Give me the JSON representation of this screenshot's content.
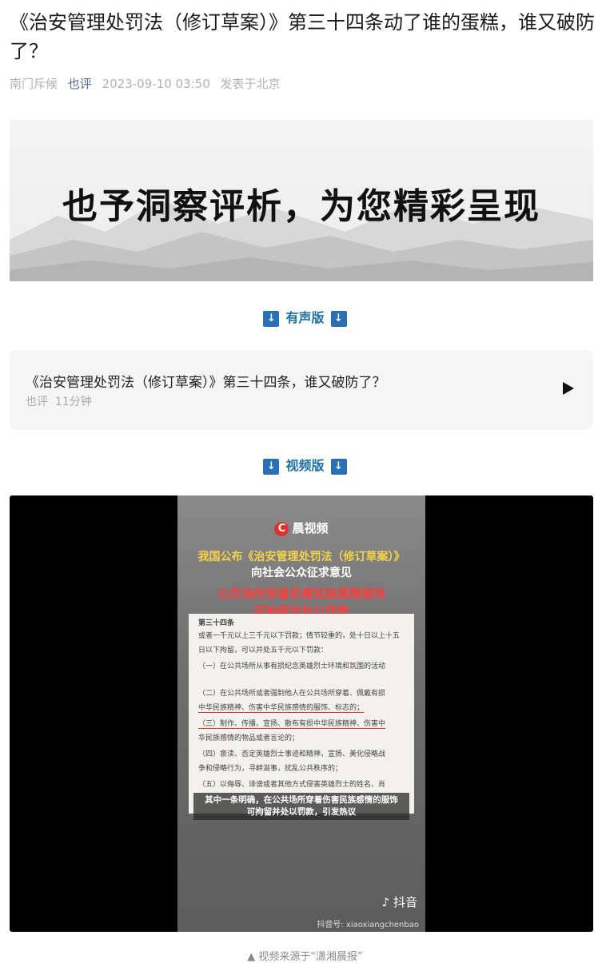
{
  "article": {
    "title": "《治安管理处罚法（修订草案）》第三十四条动了谁的蛋糕，谁又破防了？",
    "author": "南门斥候",
    "account": "也评",
    "datetime": "2023-09-10 03:50",
    "location": "发表于北京"
  },
  "banner": {
    "text": "也予洞察评析，为您精彩呈现"
  },
  "sections": {
    "audio_label": "有声版",
    "video_label": "视频版",
    "arrow_icon": "↓"
  },
  "audio": {
    "title": "《治安管理处罚法（修订草案）》第三十四条，谁又破防了？",
    "source": "也评",
    "duration": "11分钟"
  },
  "video": {
    "brand": "晨视频",
    "headline1": "我国公布《治安管理处罚法（修订草案）》",
    "headline2": "向社会公众征求意见",
    "headline3": "公共场所穿着伤害民族感情服饰",
    "headline4": "可拘留并处以罚款",
    "doc_lines": [
      "第三十四条",
      "或者一千元以上三千元以下罚款；情节较重的，处十日以上十五",
      "日以下拘留，可以并处五千元以下罚款：",
      "（一）在公共场所从事有损纪念英雄烈士环境和氛围的活动",
      "（二）在公共场所或者强制他人在公共场所穿着、佩戴有损",
      "中华民族精神、伤害中华民族感情的服饰、标志的；",
      "（三）制作、传播、宣扬、散布有损中华民族精神、伤害中",
      "华民族感情的物品或者言论的；",
      "（四）亵渎、否定英雄烈士事迹和精神，宣扬、美化侵略战",
      "争和侵略行为，寻衅滋事，扰乱公共秩序的；",
      "（五）以侮辱、诽谤或者其他方式侵害英雄烈士的姓名、肖"
    ],
    "caption1": "其中一条明确，在公共场所穿着伤害民族感情的服饰",
    "caption2": "可拘留并处以罚款，引发热议",
    "platform": "抖音",
    "platform_id": "抖音号: xiaoxiangchenbao"
  },
  "footnote": "▲ 视频来源于“潇湘晨报”"
}
